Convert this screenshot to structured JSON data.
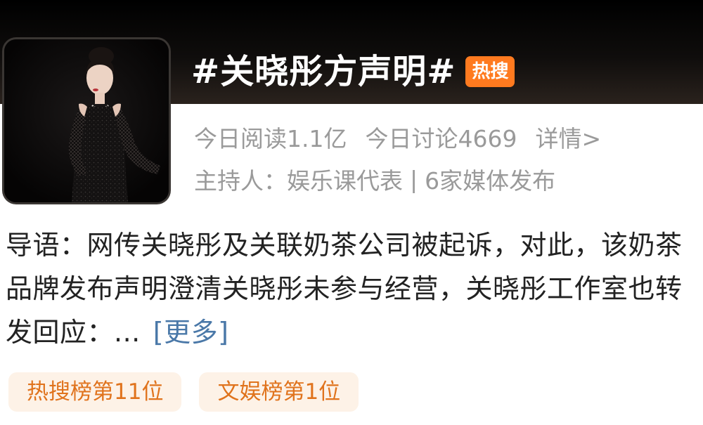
{
  "topic": {
    "title": "#关晓彤方声明#",
    "badge": "热搜",
    "cover_alt": "关晓彤"
  },
  "stats": {
    "reads": "今日阅读1.1亿",
    "discussions": "今日讨论4669",
    "details_link": "详情>"
  },
  "host": {
    "label": "主持人：娱乐课代表",
    "separator": "|",
    "media": "6家媒体发布"
  },
  "intro": {
    "text": "导语：网传关晓彤及关联奶茶公司被起诉，对此，该奶茶品牌发布声明澄清关晓彤未参与经营，关晓彤工作室也转发回应：...",
    "more_link": "[更多]"
  },
  "tags": [
    "热搜榜第11位",
    "文娱榜第1位"
  ],
  "colors": {
    "badge": "#ff7a1f",
    "link": "#4a78a8",
    "tag_bg": "#fdf2e7",
    "tag_text": "#e0731c"
  }
}
